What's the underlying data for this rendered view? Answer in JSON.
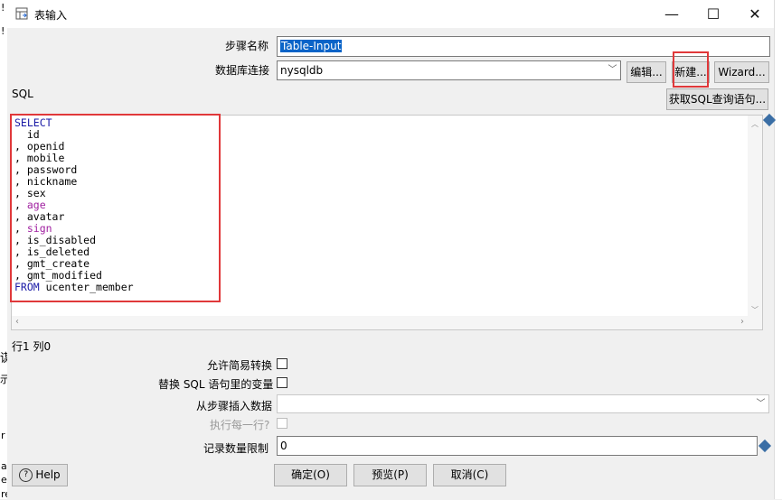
{
  "window": {
    "title": "表输入",
    "minimize_glyph": "—",
    "maximize_glyph": "☐",
    "close_glyph": "✕"
  },
  "background_app": {
    "fragments": [
      "!",
      "!",
      "谋",
      "示",
      "r",
      "a",
      "e",
      "reate"
    ]
  },
  "form": {
    "step_name_label": "步骤名称",
    "step_name_value": "Table-Input",
    "db_conn_label": "数据库连接",
    "db_conn_value": "nysqldb",
    "edit_button": "编辑...",
    "new_button": "新建...",
    "wizard_button": "Wizard...",
    "sql_label": "SQL",
    "get_sql_button": "获取SQL查询语句...",
    "cursor_position": "行1 列0",
    "allow_lazy_conversion_label": "允许简易转换",
    "replace_variables_label": "替换 SQL 语句里的变量",
    "insert_from_step_label": "从步骤插入数据",
    "insert_from_step_value": "",
    "execute_each_row_label": "执行每一行?",
    "limit_label": "记录数量限制",
    "limit_value": "0"
  },
  "sql": {
    "lines": [
      {
        "prefix": "",
        "keyword": "SELECT",
        "text": ""
      },
      {
        "prefix": "  ",
        "keyword": "",
        "text": "id"
      },
      {
        "prefix": ", ",
        "keyword": "",
        "text": "openid"
      },
      {
        "prefix": ", ",
        "keyword": "",
        "text": "mobile"
      },
      {
        "prefix": ", ",
        "keyword": "",
        "text": "password"
      },
      {
        "prefix": ", ",
        "keyword": "",
        "text": "nickname"
      },
      {
        "prefix": ", ",
        "keyword": "",
        "text": "sex"
      },
      {
        "prefix": ", ",
        "keyword": "",
        "func": "age"
      },
      {
        "prefix": ", ",
        "keyword": "",
        "text": "avatar"
      },
      {
        "prefix": ", ",
        "keyword": "",
        "func": "sign"
      },
      {
        "prefix": ", ",
        "keyword": "",
        "text": "is_disabled"
      },
      {
        "prefix": ", ",
        "keyword": "",
        "text": "is_deleted"
      },
      {
        "prefix": ", ",
        "keyword": "",
        "text": "gmt_create"
      },
      {
        "prefix": ", ",
        "keyword": "",
        "text": "gmt_modified"
      },
      {
        "prefix": "",
        "keyword": "FROM",
        "text": " ucenter_member"
      }
    ]
  },
  "footer": {
    "help_button": "Help",
    "ok_button": "确定(O)",
    "preview_button": "预览(P)",
    "cancel_button": "取消(C)"
  },
  "colors": {
    "keyword": "#1a1aa6",
    "function": "#a020a0",
    "highlight_box": "#e0383a",
    "selection": "#0a64c8"
  }
}
